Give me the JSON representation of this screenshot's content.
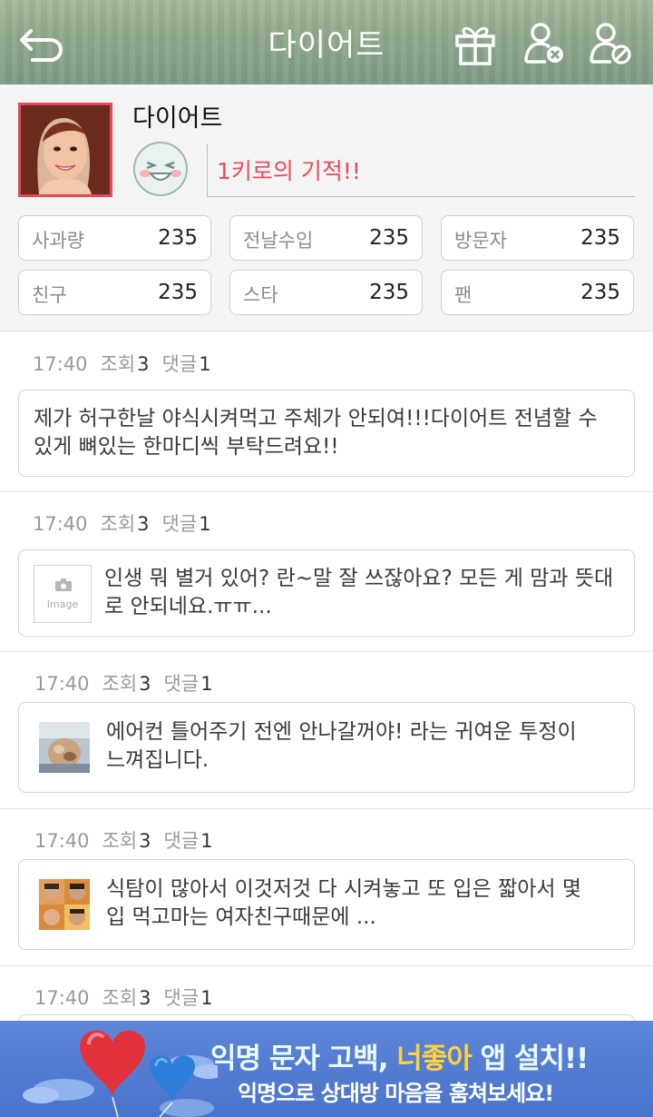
{
  "header": {
    "title": "다이어트"
  },
  "profile": {
    "nickname": "다이어트",
    "status_message": "1키로의 기적!!",
    "stats": [
      {
        "label": "사과량",
        "value": "235"
      },
      {
        "label": "전날수입",
        "value": "235"
      },
      {
        "label": "방문자",
        "value": "235"
      },
      {
        "label": "친구",
        "value": "235"
      },
      {
        "label": "스타",
        "value": "235"
      },
      {
        "label": "팬",
        "value": "235"
      }
    ]
  },
  "posts": [
    {
      "time": "17:40",
      "views_label": "조회",
      "views": "3",
      "comments_label": "댓글",
      "comments": "1",
      "text": "제가 허구한날 야식시켜먹고 주체가 안되여!!!다이어트 전념할 수 있게 뼈있는 한마디씩 부탁드려요!!"
    },
    {
      "time": "17:40",
      "views_label": "조회",
      "views": "3",
      "comments_label": "댓글",
      "comments": "1",
      "image_placeholder": "Image",
      "text": "인생 뭐 별거 있어? 란~말 잘 쓰잖아요? 모든 게 맘과 뜻대로 안되네요.ㅠㅠ..."
    },
    {
      "time": "17:40",
      "views_label": "조회",
      "views": "3",
      "comments_label": "댓글",
      "comments": "1",
      "text": "에어컨 틀어주기 전엔 안나갈꺼야! 라는 귀여운 투정이 느껴집니다."
    },
    {
      "time": "17:40",
      "views_label": "조회",
      "views": "3",
      "comments_label": "댓글",
      "comments": "1",
      "text": "식탐이 많아서 이것저것 다 시켜놓고 또 입은 짧아서 몇입 먹고마는 여자친구때문에 ..."
    },
    {
      "time": "17:40",
      "views_label": "조회",
      "views": "3",
      "comments_label": "댓글",
      "comments": "1"
    }
  ],
  "banner": {
    "line1_part1": "익명 문자 고백, ",
    "line1_highlight": "너좋아",
    "line1_part2": " 앱 설치!!",
    "line2": "익명으로 상대방 마음을 훔쳐보세요!"
  },
  "colors": {
    "accent_red": "#ec4a5a",
    "header_green": "#8fa88c",
    "banner_blue": "#4a73cb"
  }
}
